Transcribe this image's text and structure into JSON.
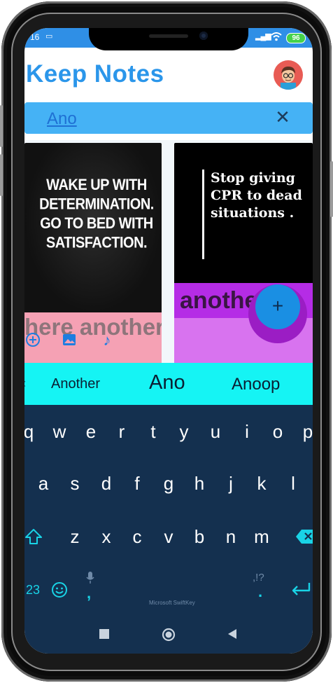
{
  "status_bar": {
    "time": "16",
    "battery": "96"
  },
  "app": {
    "title": "Keep Notes"
  },
  "search": {
    "value": "Ano"
  },
  "notes": [
    {
      "image_quote": "WAKE UP WITH DETERMINATION. GO TO BED WITH SATISFACTION.",
      "title": "here another"
    },
    {
      "image_quote": "Stop giving CPR to dead situations .",
      "title": "another"
    }
  ],
  "fab": {
    "label": "+"
  },
  "suggestions": [
    "Another",
    "Ano",
    "Anoop"
  ],
  "keyboard": {
    "row1": [
      "q",
      "w",
      "e",
      "r",
      "t",
      "y",
      "u",
      "i",
      "o",
      "p"
    ],
    "row2": [
      "a",
      "s",
      "d",
      "f",
      "g",
      "h",
      "j",
      "k",
      "l"
    ],
    "row3": [
      "z",
      "x",
      "c",
      "v",
      "b",
      "n",
      "m"
    ],
    "numbers_label": "23",
    "comma_label": ",",
    "period_label": ".",
    "punct_label": ",!?",
    "brand": "Microsoft SwiftKey"
  },
  "colors": {
    "accent": "#2b96ea",
    "search_bg": "#45b2f5",
    "suggest_bg": "#15f4f4",
    "keyboard_bg": "#14304f"
  }
}
